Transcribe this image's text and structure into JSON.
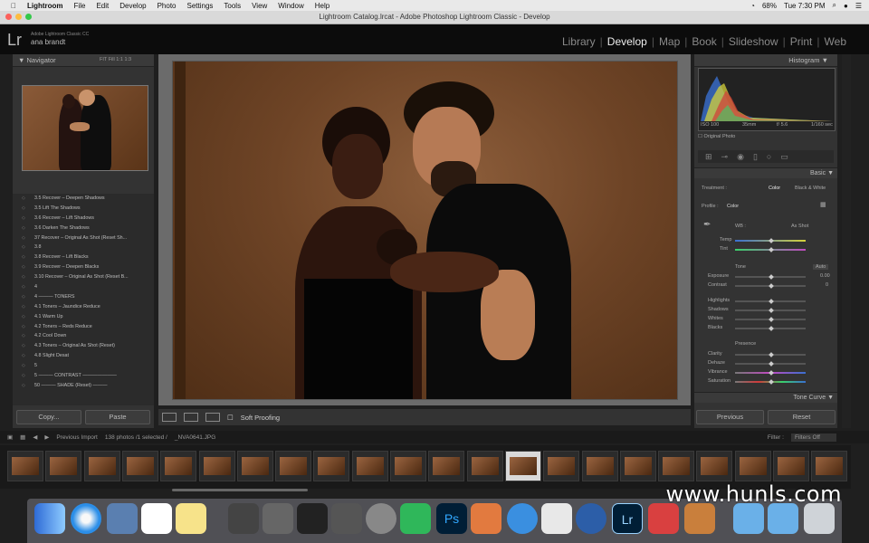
{
  "menubar": {
    "apple": "",
    "items": [
      "Lightroom",
      "File",
      "Edit",
      "Develop",
      "Photo",
      "Settings",
      "Tools",
      "View",
      "Window",
      "Help"
    ],
    "battery": "68%",
    "clock": "Tue 7:30 PM"
  },
  "window": {
    "title": "Lightroom Catalog.lrcat - Adobe Photoshop Lightroom Classic - Develop"
  },
  "identity": {
    "logo": "Lr",
    "product": "Adobe Lightroom Classic CC",
    "user": "ana brandt"
  },
  "modules": [
    "Library",
    "Develop",
    "Map",
    "Book",
    "Slideshow",
    "Print",
    "Web"
  ],
  "active_module": "Develop",
  "left": {
    "navigator_title": "Navigator",
    "zoom_options": [
      "FIT",
      "Fill",
      "1:1",
      "1:3"
    ],
    "history": [
      "3.5    Recover – Deepen Shadows",
      "3.5  Lift The Shadows",
      "3.6    Recover – Lift Shadows",
      "3.6  Darken The Shadows",
      "37    Recover – Original As Shot (Reset Sh...",
      "3.8",
      "3.8    Recover – Lift Blacks",
      "3.9    Recover – Deepen Blacks",
      "3.10  Recover – Original As Shot (Reset B...",
      "4",
      "4 ——— TONERS",
      "4.1      Toners – Jaundice Reduce",
      "4.1  Warm Up",
      "4.2      Toners – Reds Reduce",
      "4.2  Cool Down",
      "4.3      Toners – Original As Shot (Reset)",
      "4.8  Slight Desat",
      "5",
      "5 ——— CONTRAST ———————",
      "50 ——— SHADE (Reset) ———"
    ],
    "copy_label": "Copy...",
    "paste_label": "Paste"
  },
  "toolbar": {
    "soft_proofing": "Soft Proofing"
  },
  "right": {
    "histogram_title": "Histogram",
    "histo_stats": [
      "ISO 100",
      "35mm",
      "f/ 5.6",
      "1/160 sec"
    ],
    "original_photo": "Original Photo",
    "basic_title": "Basic",
    "treatment_label": "Treatment :",
    "treatment_color": "Color",
    "treatment_bw": "Black & White",
    "profile_label": "Profile :",
    "profile_value": "Color",
    "wb_label": "WB :",
    "wb_value": "As Shot",
    "temp_label": "Temp",
    "tint_label": "Tint",
    "tone_label": "Tone",
    "auto_label": "Auto",
    "exposure_label": "Exposure",
    "exposure_value": "0.00",
    "contrast_label": "Contrast",
    "contrast_value": "0",
    "highlights_label": "Highlights",
    "shadows_label": "Shadows",
    "whites_label": "Whites",
    "blacks_label": "Blacks",
    "presence_label": "Presence",
    "clarity_label": "Clarity",
    "dehaze_label": "Dehaze",
    "vibrance_label": "Vibrance",
    "saturation_label": "Saturation",
    "tonecurve_title": "Tone Curve",
    "previous_label": "Previous",
    "reset_label": "Reset"
  },
  "filmstrip": {
    "source": "Previous Import",
    "count": "138 photos /1 selected /",
    "filename": "_NVA0641.JPG",
    "filter_label": "Filter :",
    "filter_value": "Filters Off"
  },
  "watermark": "www.hunls.com",
  "colors": {
    "accent": "#cfcfcf",
    "panel": "#333333",
    "background": "#1f1f1f"
  }
}
